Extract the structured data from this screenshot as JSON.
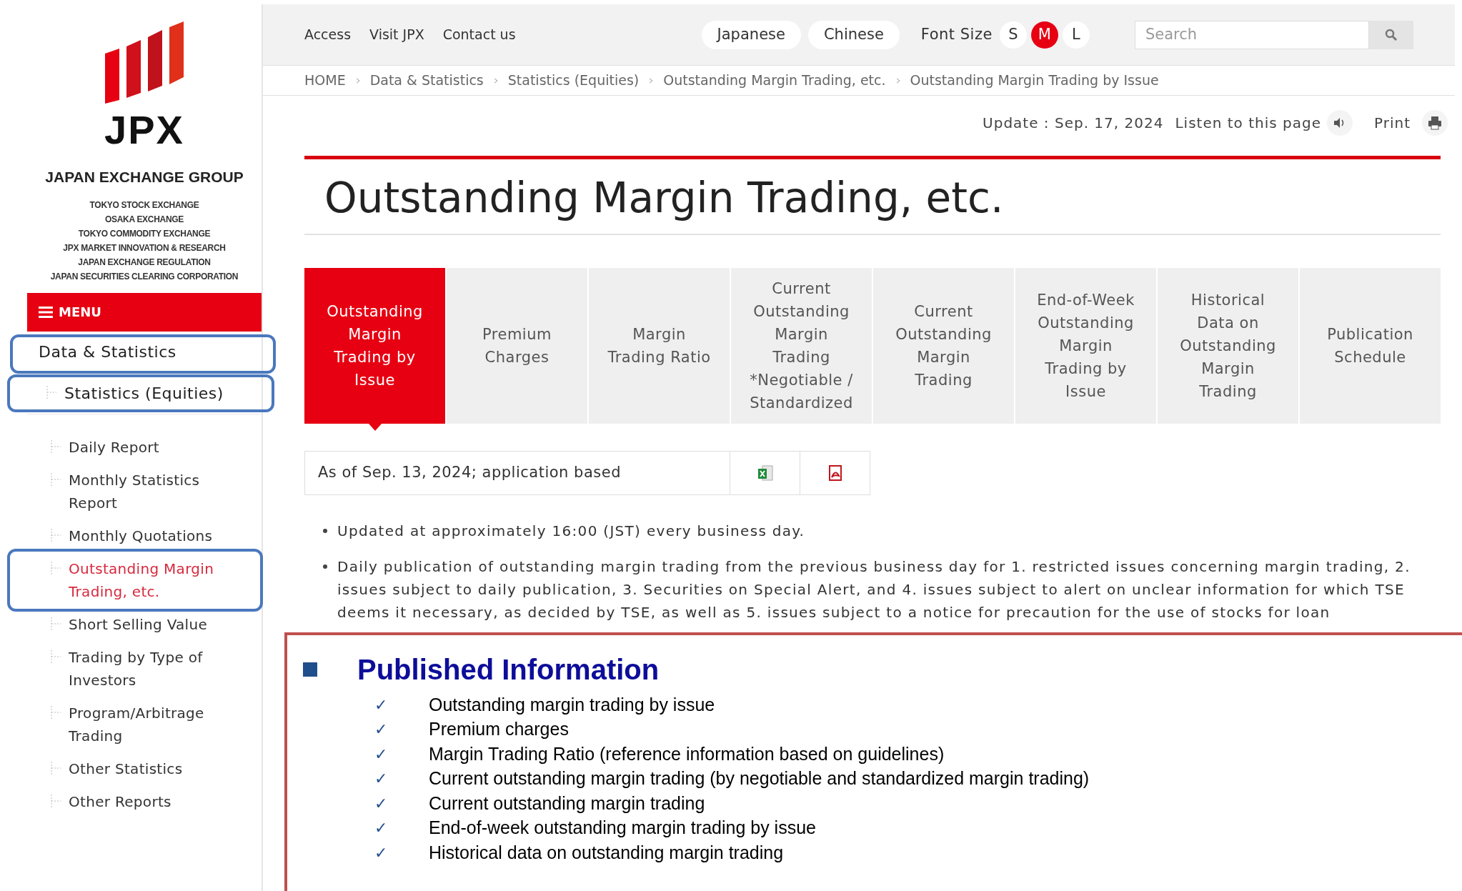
{
  "sidebar": {
    "logo": {
      "wordmark": "JPX",
      "group": "JAPAN EXCHANGE GROUP",
      "members": [
        "TOKYO STOCK EXCHANGE",
        "OSAKA EXCHANGE",
        "TOKYO COMMODITY EXCHANGE",
        "JPX MARKET INNOVATION & RESEARCH",
        "JAPAN EXCHANGE REGULATION",
        "JAPAN SECURITIES CLEARING CORPORATION"
      ]
    },
    "menu": "MENU",
    "items": [
      {
        "label": "Data & Statistics",
        "highlighted": true,
        "selected": false,
        "children": [
          {
            "label": "Statistics (Equities)",
            "highlighted": true,
            "selected": false,
            "children": [
              {
                "label": "Daily Report",
                "highlighted": false,
                "selected": false
              },
              {
                "label": "Monthly Statistics Report",
                "highlighted": false,
                "selected": false
              },
              {
                "label": "Monthly Quotations",
                "highlighted": false,
                "selected": false
              },
              {
                "label": "Outstanding Margin Trading, etc.",
                "highlighted": true,
                "selected": true
              },
              {
                "label": "Short Selling Value",
                "highlighted": false,
                "selected": false
              },
              {
                "label": "Trading by Type of Investors",
                "highlighted": false,
                "selected": false
              },
              {
                "label": "Program/Arbitrage Trading",
                "highlighted": false,
                "selected": false
              },
              {
                "label": "Other Statistics",
                "highlighted": false,
                "selected": false
              },
              {
                "label": "Other Reports",
                "highlighted": false,
                "selected": false
              }
            ]
          }
        ]
      }
    ]
  },
  "header": {
    "links": [
      "Access",
      "Visit JPX",
      "Contact us"
    ],
    "languages": [
      "Japanese",
      "Chinese"
    ],
    "font_size": {
      "label": "Font Size",
      "options": [
        {
          "label": "S",
          "selected": false
        },
        {
          "label": "M",
          "selected": true
        },
        {
          "label": "L",
          "selected": false
        }
      ]
    },
    "search": {
      "placeholder": "Search"
    }
  },
  "breadcrumb": [
    "HOME",
    "Data & Statistics",
    "Statistics (Equities)",
    "Outstanding Margin Trading, etc.",
    "Outstanding Margin Trading by Issue"
  ],
  "update": "Update : Sep. 17, 2024",
  "listen": "Listen to this page",
  "print": "Print",
  "page_title": "Outstanding Margin Trading, etc.",
  "tabs": [
    {
      "label": "Outstanding Margin Trading by Issue",
      "selected": true
    },
    {
      "label": "Premium Charges",
      "selected": false
    },
    {
      "label": "Margin Trading Ratio",
      "selected": false
    },
    {
      "label": "Current Outstanding Margin Trading *Negotiable / Standardized",
      "selected": false
    },
    {
      "label": "Current Outstanding Margin Trading",
      "selected": false
    },
    {
      "label": "End-of-Week Outstanding Margin Trading by Issue",
      "selected": false
    },
    {
      "label": "Historical Data on Outstanding Margin Trading",
      "selected": false
    },
    {
      "label": "Publication Schedule",
      "selected": false
    }
  ],
  "download": {
    "text": "As of Sep. 13, 2024; application based"
  },
  "notes": [
    "Updated at approximately 16:00 (JST) every business day.",
    "Daily publication of outstanding margin trading from the previous business day for 1. restricted issues concerning margin trading, 2. issues subject to daily publication, 3. Securities on Special Alert, and 4. issues subject to alert on unclear information for which TSE deems it necessary, as decided by TSE, as well as 5. issues subject to a notice for precaution for the use of stocks for loan"
  ],
  "callout": {
    "title": "Published Information",
    "items": [
      "Outstanding margin trading by issue",
      "Premium charges",
      "Margin Trading Ratio (reference information based on guidelines)",
      "Current outstanding margin trading (by negotiable and standardized margin trading)",
      "Current outstanding margin trading",
      "End-of-week outstanding margin trading by issue",
      "Historical data on outstanding margin trading"
    ],
    "check": "✓"
  }
}
